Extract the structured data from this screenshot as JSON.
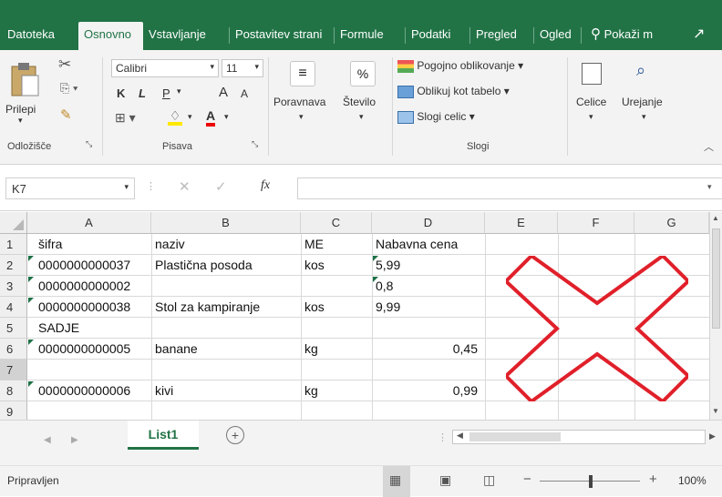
{
  "tabs": [
    "Datoteka",
    "Osnovno",
    "Vstavljanje",
    "Postavitev strani",
    "Formule",
    "Podatki",
    "Pregled",
    "Ogled",
    "Pokaži m"
  ],
  "ribbon": {
    "paste": "Prilepi",
    "clipboard_group": "Odložišče",
    "font_name": "Calibri",
    "font_size": "11",
    "bold": "K",
    "italic": "L",
    "underline": "P",
    "grow": "A",
    "shrink": "A",
    "font_color": "A",
    "font_group": "Pisava",
    "alignment": "Poravnava",
    "number": "Število",
    "number_symbol": "%",
    "cond_format": "Pogojno oblikovanje",
    "format_table": "Oblikuj kot tabelo",
    "cell_styles": "Slogi celic",
    "styles_group": "Slogi",
    "cells": "Celice",
    "editing": "Urejanje"
  },
  "formula_bar": {
    "name_box": "K7",
    "fx": "fx",
    "value": ""
  },
  "columns": [
    "A",
    "B",
    "C",
    "D",
    "E",
    "F",
    "G"
  ],
  "rows": [
    "1",
    "2",
    "3",
    "4",
    "5",
    "6",
    "7",
    "8",
    "9"
  ],
  "cells": [
    [
      "šifra",
      "naziv",
      "ME",
      "Nabavna cena"
    ],
    [
      "0000000000037",
      "Plastična posoda",
      "kos",
      "5,99"
    ],
    [
      "0000000000002",
      "",
      "",
      "0,8"
    ],
    [
      "0000000000038",
      "Stol za kampiranje",
      "kos",
      "9,99"
    ],
    [
      "SADJE",
      "",
      "",
      ""
    ],
    [
      "0000000000005",
      "banane",
      "kg",
      "0,45"
    ],
    [
      "",
      "",
      "",
      ""
    ],
    [
      "0000000000006",
      "kivi",
      "kg",
      "0,99"
    ],
    [
      "",
      "",
      "",
      ""
    ]
  ],
  "sheet_tab": "List1",
  "status": {
    "ready": "Pripravljen",
    "zoom": "100%"
  },
  "colors": {
    "excel_green": "#217346",
    "cross_red": "#e0202a"
  }
}
